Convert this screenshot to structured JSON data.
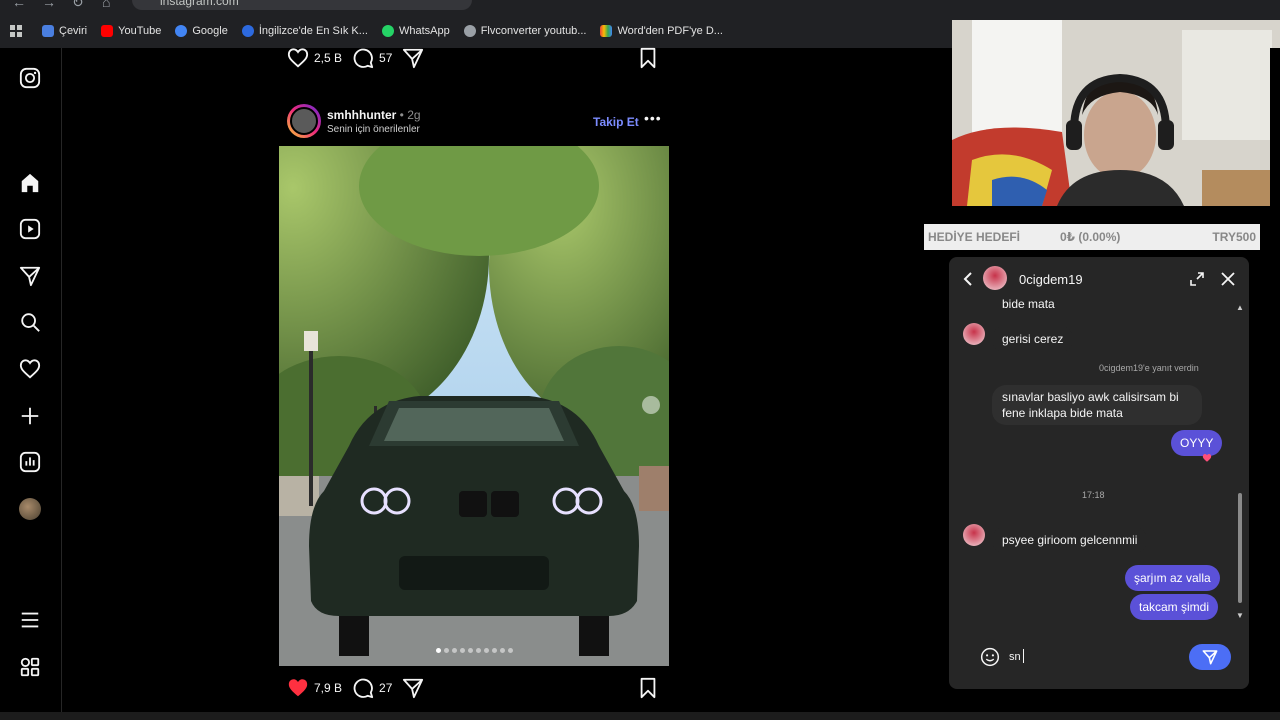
{
  "browser": {
    "url": "instagram.com",
    "bookmarks": [
      {
        "label": "Çeviri",
        "color": "#4a7fe0"
      },
      {
        "label": "YouTube",
        "color": "#ff0000"
      },
      {
        "label": "Google",
        "color": "#4285f4"
      },
      {
        "label": "İngilizce'de En Sık K...",
        "color": "#2d6adf"
      },
      {
        "label": "WhatsApp",
        "color": "#25d366"
      },
      {
        "label": "Flvconverter youtub...",
        "color": "#9aa0a6"
      },
      {
        "label": "Word'den PDF'ye D...",
        "color": "#e94235"
      }
    ]
  },
  "sidebar": {
    "items": [
      "instagram-logo-icon",
      "home-icon",
      "reels-icon",
      "messages-icon",
      "search-icon",
      "notifications-icon",
      "create-icon",
      "dashboard-icon",
      "profile-icon",
      "menu-icon",
      "apps-icon"
    ]
  },
  "prev_post": {
    "likes": "2,5 B",
    "comments": "57"
  },
  "post": {
    "username": "smhhhunter",
    "time": " • 2g",
    "subtitle": "Senin için önerilenler",
    "follow_label": "Takip Et",
    "more_label": "•••",
    "likes": "7,9 B",
    "comments": "27",
    "carousel_count": 10,
    "carousel_active": 0
  },
  "goal": {
    "label": "HEDİYE HEDEFİ",
    "progress": "0₺ (0.00%)",
    "target": "TRY500"
  },
  "chat": {
    "contact": "0cigdem19",
    "messages": {
      "m0": "bide mata",
      "m1": "gerisi cerez",
      "reply_note": "0cigdem19'e yanıt verdin",
      "m2a": "sınavlar basliyo awk calisirsam bi",
      "m2b": "fene inklapa bide mata",
      "m3": "OYYY",
      "timestamp": "17:18",
      "m4": "psyee girioom gelcennmii",
      "m5": "şarjım az valla",
      "m6": "takcam şimdi"
    },
    "input_value": "sn"
  },
  "colors": {
    "accent": "#5b51d8",
    "link": "#7c8cff",
    "like": "#ff3040"
  }
}
